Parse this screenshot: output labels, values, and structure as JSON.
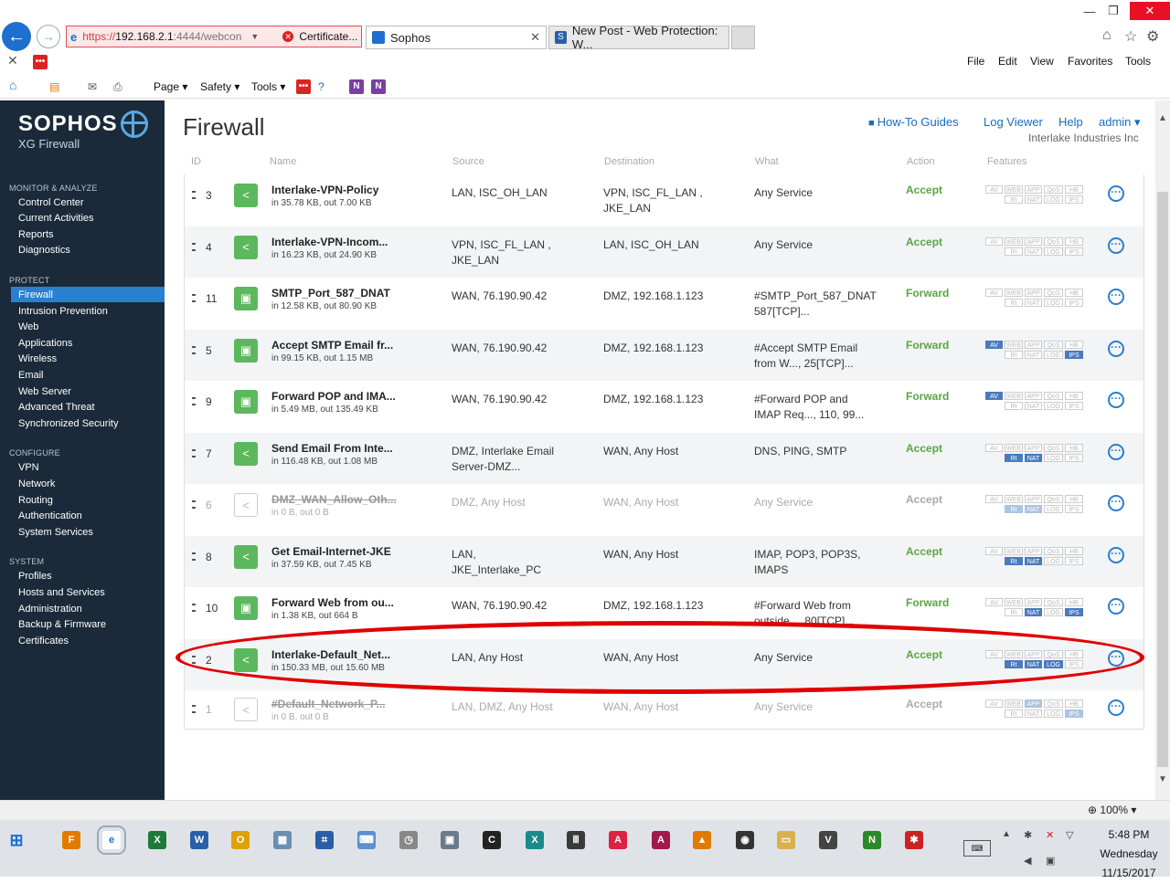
{
  "browser": {
    "url_https": "https://",
    "url_host": "192.168.2.1",
    "url_rest": ":4444/webcon",
    "cert_label": "Certificate...",
    "tabs": [
      {
        "label": "Sophos"
      },
      {
        "label": "New Post - Web Protection: W..."
      }
    ],
    "menu": [
      "File",
      "Edit",
      "View",
      "Favorites",
      "Tools"
    ],
    "commands": [
      "Page ▾",
      "Safety ▾",
      "Tools ▾"
    ]
  },
  "sidebar": {
    "brand": "SOPHOS",
    "subtitle": "XG Firewall",
    "sections": [
      {
        "title": "MONITOR & ANALYZE",
        "items": [
          "Control Center",
          "Current Activities",
          "Reports",
          "Diagnostics"
        ]
      },
      {
        "title": "PROTECT",
        "items": [
          "Firewall",
          "Intrusion Prevention",
          "Web",
          "Applications",
          "Wireless",
          "Email",
          "Web Server",
          "Advanced Threat",
          "Synchronized Security"
        ]
      },
      {
        "title": "CONFIGURE",
        "items": [
          "VPN",
          "Network",
          "Routing",
          "Authentication",
          "System Services"
        ]
      },
      {
        "title": "SYSTEM",
        "items": [
          "Profiles",
          "Hosts and Services",
          "Administration",
          "Backup & Firmware",
          "Certificates"
        ]
      }
    ],
    "active": "Firewall"
  },
  "header": {
    "title": "Firewall",
    "links": [
      "How-To Guides",
      "Log Viewer",
      "Help",
      "admin ▾"
    ],
    "org": "Interlake Industries Inc"
  },
  "table": {
    "columns": [
      "ID",
      "Name",
      "Source",
      "Destination",
      "What",
      "Action",
      "Features"
    ],
    "feature_labels": [
      "AV",
      "WEB",
      "APP",
      "QoS",
      "HB",
      "Rt",
      "NAT",
      "LOG",
      "IPS"
    ],
    "rules": [
      {
        "id": "3",
        "name": "Interlake-VPN-Policy",
        "stats": "in 35.78 KB, out 7.00 KB",
        "source": [
          "LAN, ISC_OH_LAN"
        ],
        "destination": [
          "VPN, ISC_FL_LAN ,",
          "JKE_LAN"
        ],
        "what": [
          "Any Service"
        ],
        "action": "Accept",
        "enabled": true,
        "features_on": []
      },
      {
        "id": "4",
        "name": "Interlake-VPN-Incom...",
        "stats": "in 16.23 KB, out 24.90 KB",
        "source": [
          "VPN, ISC_FL_LAN ,",
          "JKE_LAN"
        ],
        "destination": [
          "LAN, ISC_OH_LAN"
        ],
        "what": [
          "Any Service"
        ],
        "action": "Accept",
        "enabled": true,
        "features_on": []
      },
      {
        "id": "11",
        "name": "SMTP_Port_587_DNAT",
        "stats": "in 12.58 KB, out 80.90 KB",
        "source": [
          "WAN, 76.190.90.42"
        ],
        "destination": [
          "DMZ, 192.168.1.123"
        ],
        "what": [
          "#SMTP_Port_587_DNAT",
          "587[TCP]..."
        ],
        "action": "Forward",
        "enabled": true,
        "features_on": []
      },
      {
        "id": "5",
        "name": "Accept SMTP Email fr...",
        "stats": "in 99.15 KB, out 1.15 MB",
        "source": [
          "WAN, 76.190.90.42"
        ],
        "destination": [
          "DMZ, 192.168.1.123"
        ],
        "what": [
          "#Accept SMTP Email",
          "from W..., 25[TCP]..."
        ],
        "action": "Forward",
        "enabled": true,
        "features_on": [
          "AV",
          "IPS"
        ]
      },
      {
        "id": "9",
        "name": "Forward POP and IMA...",
        "stats": "in 5.49 MB, out 135.49 KB",
        "source": [
          "WAN, 76.190.90.42"
        ],
        "destination": [
          "DMZ, 192.168.1.123"
        ],
        "what": [
          "#Forward POP and",
          "IMAP Req..., 110, 99..."
        ],
        "action": "Forward",
        "enabled": true,
        "features_on": [
          "AV"
        ]
      },
      {
        "id": "7",
        "name": "Send Email From Inte...",
        "stats": "in 116.48 KB, out 1.08 MB",
        "source": [
          "DMZ, Interlake Email",
          "Server-DMZ..."
        ],
        "destination": [
          "WAN, Any Host"
        ],
        "what": [
          "DNS, PING, SMTP"
        ],
        "action": "Accept",
        "enabled": true,
        "features_on": [
          "Rt",
          "NAT"
        ]
      },
      {
        "id": "6",
        "name": "DMZ_WAN_Allow_Oth...",
        "stats": "in 0 B, out 0 B",
        "source": [
          "DMZ, Any Host"
        ],
        "destination": [
          "WAN, Any Host"
        ],
        "what": [
          "Any Service"
        ],
        "action": "Accept",
        "enabled": false,
        "features_on": [
          "Rt",
          "NAT"
        ]
      },
      {
        "id": "8",
        "name": "Get Email-Internet-JKE",
        "stats": "in 37.59 KB, out 7.45 KB",
        "source": [
          "LAN,",
          "JKE_Interlake_PC"
        ],
        "destination": [
          "WAN, Any Host"
        ],
        "what": [
          "IMAP, POP3, POP3S,",
          "IMAPS"
        ],
        "action": "Accept",
        "enabled": true,
        "features_on": [
          "Rt",
          "NAT"
        ]
      },
      {
        "id": "10",
        "name": "Forward Web from ou...",
        "stats": "in 1.38 KB, out 664 B",
        "source": [
          "WAN, 76.190.90.42"
        ],
        "destination": [
          "DMZ, 192.168.1.123"
        ],
        "what": [
          "#Forward Web from",
          "outside..., 80[TCP]..."
        ],
        "action": "Forward",
        "enabled": true,
        "features_on": [
          "NAT",
          "IPS"
        ]
      },
      {
        "id": "2",
        "name": "Interlake-Default_Net...",
        "stats": "in 150.33 MB, out 15.60 MB",
        "source": [
          "LAN, Any Host"
        ],
        "destination": [
          "WAN, Any Host"
        ],
        "what": [
          "Any Service"
        ],
        "action": "Accept",
        "enabled": true,
        "features_on": [
          "Rt",
          "NAT",
          "LOG"
        ]
      },
      {
        "id": "1",
        "name": "#Default_Network_P...",
        "stats": "in 0 B, out 0 B",
        "source": [
          "LAN, DMZ, Any Host"
        ],
        "destination": [
          "WAN, Any Host"
        ],
        "what": [
          "Any Service"
        ],
        "action": "Accept",
        "enabled": false,
        "features_on": [
          "APP",
          "IPS"
        ]
      }
    ]
  },
  "status": {
    "zoom": "100%"
  },
  "taskbar": {
    "time": "5:48 PM",
    "day": "Wednesday",
    "date": "11/15/2017"
  },
  "colors": {
    "sidebar": "#1a2a3a",
    "active_nav": "#2a7fcf",
    "accept": "#5aa642",
    "highlight_ellipse": "#e00000"
  }
}
